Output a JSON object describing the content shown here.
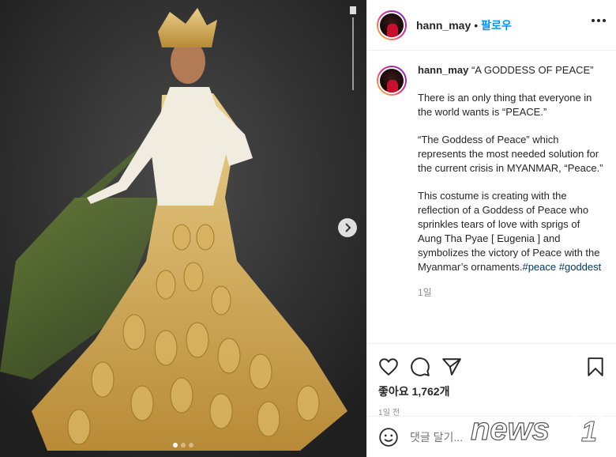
{
  "post": {
    "username": "hann_may",
    "follow_label": "팔로우",
    "separator": "•"
  },
  "caption": {
    "username": "hann_may",
    "title": "“A GODDESS OF PEACE”",
    "paragraphs": [
      "There is an only thing that everyone in the world wants is “PEACE.”",
      "“The Goddess of Peace” which represents the most needed solution for the current crisis in MYANMAR, “Peace.”",
      "This costume is creating with the reflection of a Goddess of Peace who sprinkles tears of love with sprigs of Aung Tha Pyae [ Eugenia ] and symbolizes the victory of Peace with the Myanmar’s ornaments."
    ],
    "tags": [
      "#peace",
      "#goddest"
    ],
    "time_ago": "1일"
  },
  "engagement": {
    "likes": "좋아요 1,762개",
    "date": "1일 전"
  },
  "comment": {
    "placeholder": "댓글 달기..."
  },
  "icons": {
    "like": "heart-icon",
    "comment": "comment-icon",
    "share": "paper-plane-icon",
    "save": "bookmark-icon",
    "emoji": "smiley-icon",
    "more": "more-dots-icon",
    "next": "chevron-right-icon"
  },
  "carousel": {
    "total": 3,
    "active": 1
  },
  "watermark": "news1",
  "colors": {
    "accent": "#0095f6",
    "hashtag": "#00376b",
    "muted": "#8e8e8e",
    "gold": "#c9a04a"
  }
}
